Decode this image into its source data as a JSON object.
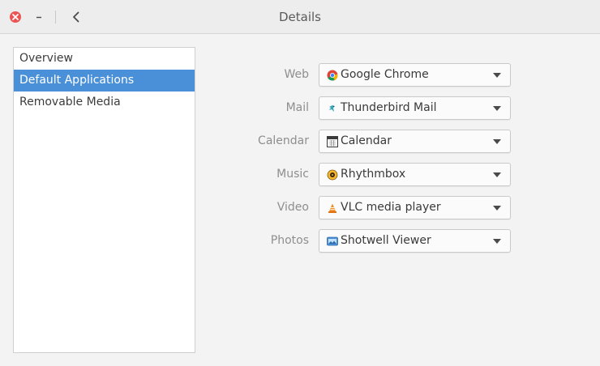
{
  "window": {
    "title": "Details"
  },
  "titlebar": {
    "close_icon": "close-icon",
    "minimize_icon": "minimize-icon",
    "back_icon": "back-chevron-icon",
    "close_color": "#ed5353"
  },
  "sidebar": {
    "items": [
      {
        "label": "Overview",
        "selected": false
      },
      {
        "label": "Default Applications",
        "selected": true
      },
      {
        "label": "Removable Media",
        "selected": false
      }
    ],
    "selected_color": "#4a90d9"
  },
  "defaults": {
    "rows": [
      {
        "label": "Web",
        "value": "Google Chrome",
        "icon": "chrome-icon"
      },
      {
        "label": "Mail",
        "value": "Thunderbird Mail",
        "icon": "thunderbird-icon"
      },
      {
        "label": "Calendar",
        "value": "Calendar",
        "icon": "calendar-icon"
      },
      {
        "label": "Music",
        "value": "Rhythmbox",
        "icon": "rhythmbox-icon"
      },
      {
        "label": "Video",
        "value": "VLC media player",
        "icon": "vlc-icon"
      },
      {
        "label": "Photos",
        "value": "Shotwell Viewer",
        "icon": "shotwell-icon"
      }
    ]
  }
}
